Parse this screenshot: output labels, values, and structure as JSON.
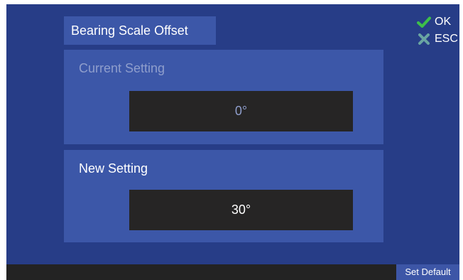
{
  "dialog": {
    "title": "Bearing Scale Offset"
  },
  "current_setting": {
    "label": "Current Setting",
    "value": "0°"
  },
  "new_setting": {
    "label": "New Setting",
    "value": "30°"
  },
  "actions": {
    "ok_label": "OK",
    "ok_icon": "check-icon",
    "esc_label": "ESC",
    "esc_icon": "x-icon"
  },
  "footer": {
    "set_default_label": "Set Default"
  },
  "colors": {
    "background": "#273d87",
    "panel": "#3c57a8",
    "value_box": "#262525",
    "ok_green": "#3dbf4a",
    "esc_teal": "#6aa5a2"
  }
}
